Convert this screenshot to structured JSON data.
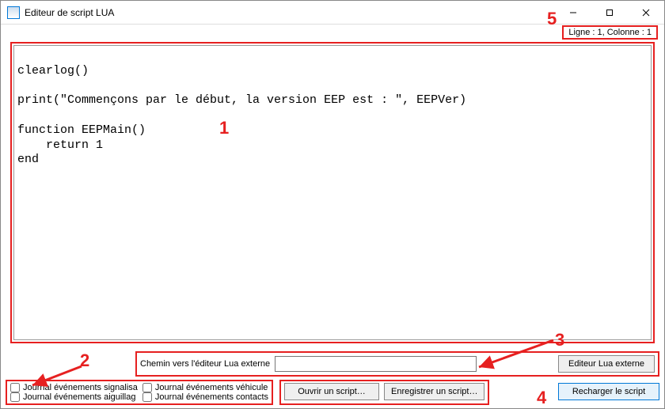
{
  "window": {
    "title": "Editeur de script LUA"
  },
  "status": {
    "cursor": "Ligne : 1, Colonne : 1"
  },
  "editor": {
    "code": "\nclearlog()\n\nprint(\"Commençons par le début, la version EEP est : \", EEPVer)\n\nfunction EEPMain()\n    return 1\nend"
  },
  "path": {
    "label": "Chemin vers l'éditeur Lua externe",
    "value": ""
  },
  "buttons": {
    "external_editor": "Editeur Lua externe",
    "open_script": "Ouvrir un script…",
    "save_script": "Enregistrer un script…",
    "reload_script": "Recharger le script"
  },
  "checkboxes": {
    "signals": "Journal événements signalisa",
    "vehicle": "Journal événements véhicule",
    "switches": "Journal événements aiguillag",
    "contacts": "Journal événements contacts"
  },
  "annotations": {
    "n1": "1",
    "n2": "2",
    "n3": "3",
    "n4": "4",
    "n5": "5"
  }
}
